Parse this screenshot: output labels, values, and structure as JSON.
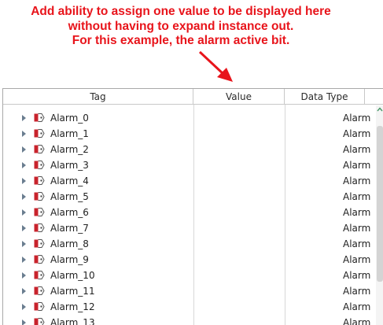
{
  "annotation": {
    "lines": [
      "Add ability to assign one value to be displayed here",
      "without having to expand instance out.",
      "For this example, the alarm active bit."
    ],
    "color": "#e8141b"
  },
  "table": {
    "columns": {
      "tag": "Tag",
      "value": "Value",
      "data_type": "Data Type"
    },
    "rows": [
      {
        "tag": "Alarm_0",
        "value": "",
        "type": "Alarm"
      },
      {
        "tag": "Alarm_1",
        "value": "",
        "type": "Alarm"
      },
      {
        "tag": "Alarm_2",
        "value": "",
        "type": "Alarm"
      },
      {
        "tag": "Alarm_3",
        "value": "",
        "type": "Alarm"
      },
      {
        "tag": "Alarm_4",
        "value": "",
        "type": "Alarm"
      },
      {
        "tag": "Alarm_5",
        "value": "",
        "type": "Alarm"
      },
      {
        "tag": "Alarm_6",
        "value": "",
        "type": "Alarm"
      },
      {
        "tag": "Alarm_7",
        "value": "",
        "type": "Alarm"
      },
      {
        "tag": "Alarm_8",
        "value": "",
        "type": "Alarm"
      },
      {
        "tag": "Alarm_9",
        "value": "",
        "type": "Alarm"
      },
      {
        "tag": "Alarm_10",
        "value": "",
        "type": "Alarm"
      },
      {
        "tag": "Alarm_11",
        "value": "",
        "type": "Alarm"
      },
      {
        "tag": "Alarm_12",
        "value": "",
        "type": "Alarm"
      },
      {
        "tag": "Alarm_13",
        "value": "",
        "type": "Alarm"
      }
    ],
    "icon": "udt-instance-icon",
    "icon_color": "#c8232c"
  }
}
